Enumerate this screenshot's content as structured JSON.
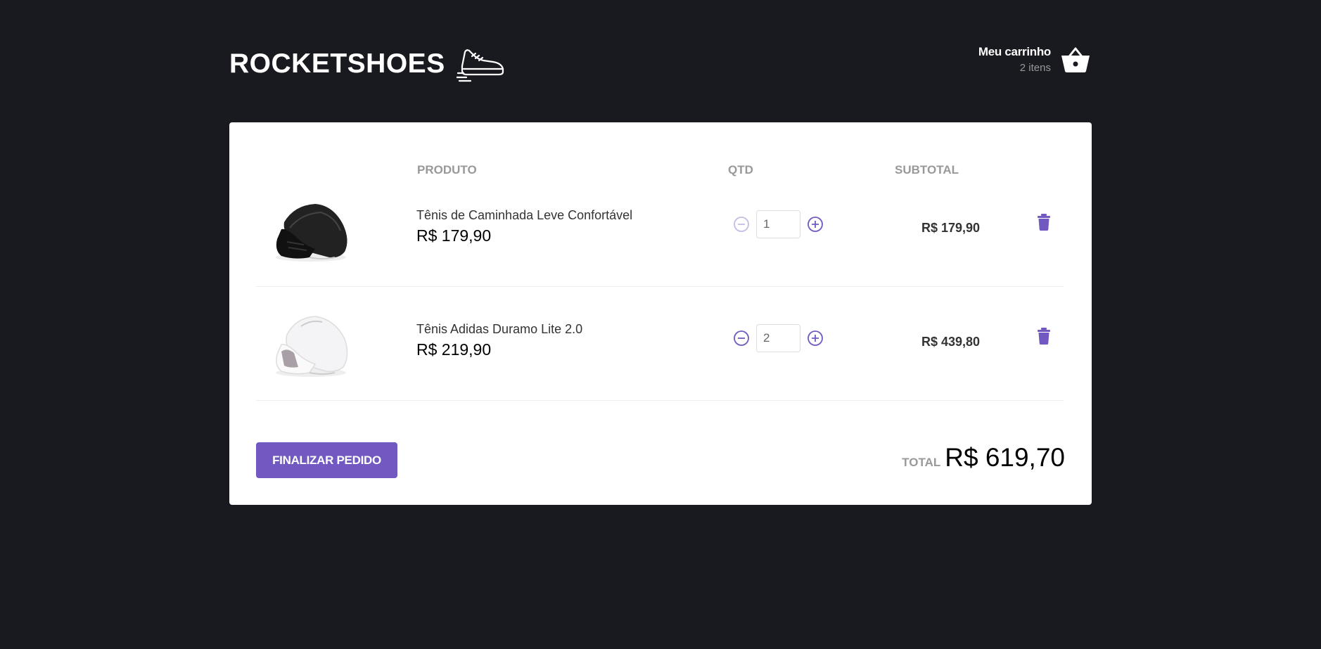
{
  "header": {
    "logo_text": "ROCKETSHOES",
    "cart_title": "Meu carrinho",
    "cart_count": "2 itens"
  },
  "table": {
    "columns": [
      "PRODUTO",
      "QTD",
      "SUBTOTAL"
    ],
    "rows": [
      {
        "image": "black-sneaker",
        "title": "Tênis de Caminhada Leve Confortável",
        "price": "R$ 179,90",
        "quantity": "1",
        "subtotal": "R$ 179,90",
        "decrement_disabled": true
      },
      {
        "image": "white-sneaker",
        "title": "Tênis Adidas Duramo Lite 2.0",
        "price": "R$ 219,90",
        "quantity": "2",
        "subtotal": "R$ 439,80",
        "decrement_disabled": false
      }
    ]
  },
  "footer": {
    "checkout_label": "FINALIZAR PEDIDO",
    "total_label": "TOTAL",
    "total_value": "R$ 619,70"
  },
  "icons": {
    "logo": "sneaker-icon",
    "cart": "basket-icon",
    "decrement": "minus-circle-icon",
    "increment": "plus-circle-icon",
    "remove": "trash-icon"
  },
  "colors": {
    "background": "#191920",
    "accent": "#7159c1",
    "panel": "#ffffff",
    "muted": "#999999"
  }
}
